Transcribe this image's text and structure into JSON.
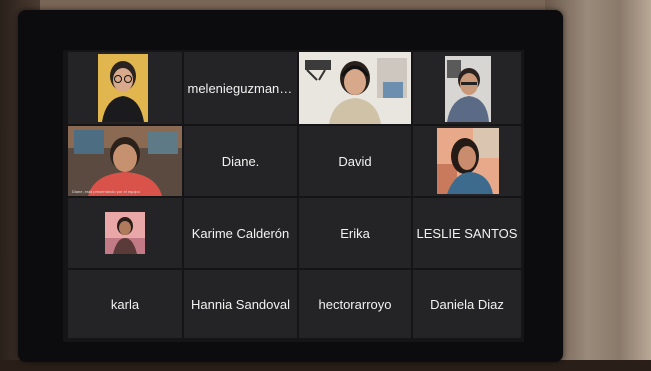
{
  "participants": [
    {
      "name": "",
      "kind": "photo",
      "desc": "woman with glasses, yellow background"
    },
    {
      "name": "melenieguzmano...",
      "kind": "name"
    },
    {
      "name": "",
      "kind": "video-active"
    },
    {
      "name": "",
      "kind": "photo"
    },
    {
      "name": "",
      "kind": "video",
      "caption": "Diane, está presentando por el equipo"
    },
    {
      "name": "Diane.",
      "kind": "name"
    },
    {
      "name": "David",
      "kind": "name"
    },
    {
      "name": "",
      "kind": "photo"
    },
    {
      "name": "",
      "kind": "photo-small"
    },
    {
      "name": "Karime Calderón",
      "kind": "name"
    },
    {
      "name": "Erika",
      "kind": "name"
    },
    {
      "name": "LESLIE SANTOS",
      "kind": "name"
    },
    {
      "name": "karla",
      "kind": "name"
    },
    {
      "name": "Hannia Sandoval",
      "kind": "name"
    },
    {
      "name": "hectorarroyo",
      "kind": "name"
    },
    {
      "name": "Daniela Diaz",
      "kind": "name"
    }
  ]
}
